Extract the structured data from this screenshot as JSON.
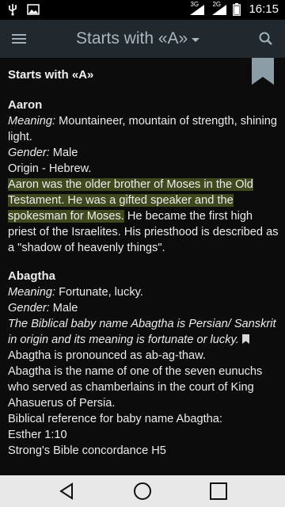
{
  "status_bar": {
    "time": "16:15",
    "network_1": "3G",
    "network_2": "2G"
  },
  "toolbar": {
    "title": "Starts with «A»",
    "icons": [
      "menu-icon",
      "dropdown-caret-icon",
      "search-icon"
    ]
  },
  "page": {
    "section_title": "Starts with «A»"
  },
  "entries": [
    {
      "name": "Aaron",
      "meaning_label": "Meaning:",
      "meaning": " Mountaineer, mountain of strength, shining light.",
      "gender_label": "Gender:",
      "gender": " Male",
      "origin": "Origin - Hebrew.",
      "highlighted": "Aaron was the older brother of Moses in the Old Testament. He was a gifted speaker and the spokesman for Moses.",
      "description": " He became the first high priest of the Israelites. His priesthood is described as a \"shadow of heavenly things\"."
    },
    {
      "name": "Abagtha",
      "meaning_label": "Meaning:",
      "meaning": " Fortunate, lucky.",
      "gender_label": "Gender:",
      "gender": " Male",
      "italic_note": "The Biblical baby name Abagtha is Persian/ Sanskrit in origin and its meaning is fortunate or lucky.",
      "pronunciation": "Abagtha is pronounced as ab-ag-thaw.",
      "description": "Abagtha is the name of one of the seven eunuchs who served as chamberlains in the court of King Ahasuerus of Persia.",
      "reference_label": "Biblical reference for baby name Abagtha:",
      "reference": "Esther 1:10",
      "concordance": "Strong's Bible concordance H5"
    }
  ],
  "colors": {
    "toolbar_bg": "#22292e",
    "background": "#0c0c0c",
    "highlight": "#3e4a1e",
    "bookmark": "#8b9ea8"
  }
}
